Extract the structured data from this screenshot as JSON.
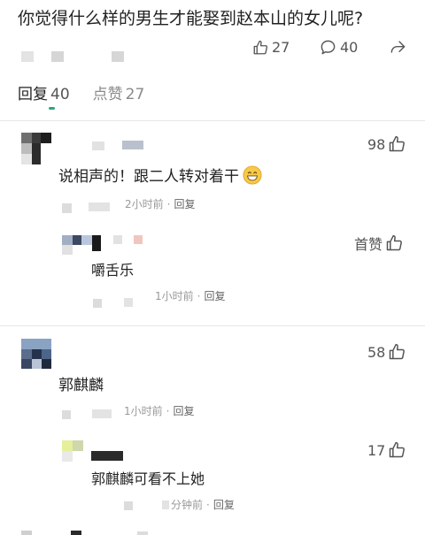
{
  "post": {
    "title": "你觉得什么样的男生才能娶到赵本山的女儿呢?",
    "likes": "27",
    "comments": "40"
  },
  "tabs": [
    {
      "label": "回复",
      "count": "40"
    },
    {
      "label": "点赞",
      "count": "27"
    }
  ],
  "comments": [
    {
      "text": "说相声的！跟二人转对着干",
      "likes": "98",
      "time": "2小时前",
      "reply_label": "回复",
      "reply": {
        "text": "嚼舌乐",
        "likes": "首赞",
        "time": "1小时前",
        "reply_label": "回复"
      }
    },
    {
      "text": "郭麒麟",
      "likes": "58",
      "time": "1小时前",
      "reply_label": "回复",
      "reply": {
        "text": "郭麒麟可看不上她",
        "likes": "17",
        "time": "分钟前",
        "reply_label": "回复"
      }
    }
  ],
  "icons": {
    "like": "thumbs-up-icon",
    "comment": "speech-bubble-icon",
    "share": "share-arrow-icon",
    "emoji": "grinning-face-icon"
  },
  "colors": {
    "text": "#222222",
    "muted": "#999999",
    "tab_indicator": "#2aa876",
    "emoji": "#f7c948"
  }
}
